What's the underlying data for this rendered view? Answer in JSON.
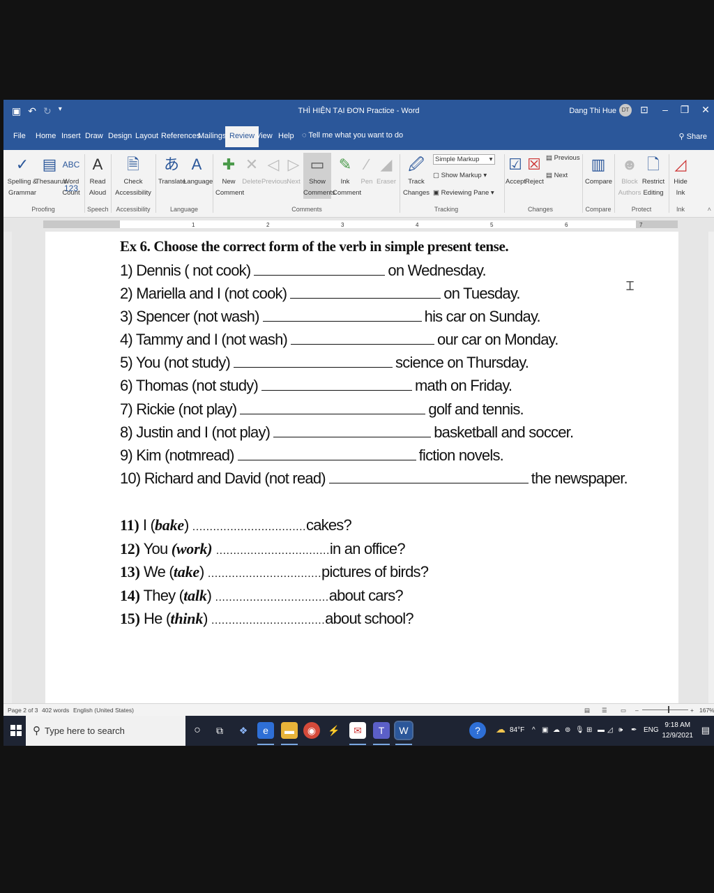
{
  "window": {
    "title": "THÌ HIỆN TẠI ĐƠN Practice  -  Word",
    "user": "Dang Thi Hue",
    "avatar_initials": "DT"
  },
  "tabs": [
    {
      "label": "File"
    },
    {
      "label": "Home"
    },
    {
      "label": "Insert"
    },
    {
      "label": "Draw"
    },
    {
      "label": "Design"
    },
    {
      "label": "Layout"
    },
    {
      "label": "References"
    },
    {
      "label": "Mailings"
    },
    {
      "label": "Review"
    },
    {
      "label": "View"
    },
    {
      "label": "Help"
    }
  ],
  "tell_me": "Tell me what you want to do",
  "share": "Share",
  "ribbon": {
    "spelling": "Spelling &\nGrammar",
    "thesaurus": "Thesaurus",
    "word_count": "Word\nCount",
    "read_aloud": "Read\nAloud",
    "check_accessibility": "Check\nAccessibility",
    "translate": "Translate",
    "language": "Language",
    "new_comment": "New\nComment",
    "delete": "Delete",
    "previous": "Previous",
    "next": "Next",
    "show_comments": "Show\nComments",
    "ink_comment": "Ink\nComment",
    "pen": "Pen",
    "eraser": "Eraser",
    "track_changes": "Track\nChanges",
    "simple_markup": "Simple Markup",
    "show_markup": "Show Markup",
    "reviewing_pane": "Reviewing Pane",
    "accept": "Accept",
    "reject": "Reject",
    "prev_change": "Previous",
    "next_change": "Next",
    "compare": "Compare",
    "block_authors": "Block\nAuthors",
    "restrict_editing": "Restrict\nEditing",
    "hide_ink": "Hide\nInk",
    "groups": {
      "proofing": "Proofing",
      "speech": "Speech",
      "accessibility": "Accessibility",
      "language": "Language",
      "comments": "Comments",
      "tracking": "Tracking",
      "changes": "Changes",
      "compare": "Compare",
      "protect": "Protect",
      "ink": "Ink"
    }
  },
  "ruler_numbers": [
    "1",
    "2",
    "3",
    "4",
    "5",
    "6",
    "7"
  ],
  "document": {
    "heading": "Ex 6. Choose the correct form of the verb in simple present tense.",
    "part1": [
      {
        "before": "1) Dennis ( not cook)",
        "after": "on Wednesday."
      },
      {
        "before": "2) Mariella and I (not cook)",
        "after": "on Tuesday."
      },
      {
        "before": "3) Spencer (not wash)",
        "after": "his car on Sunday."
      },
      {
        "before": "4) Tammy and I (not wash)",
        "after": "our car on Monday."
      },
      {
        "before": "5) You (not study)",
        "after": "science on Thursday."
      },
      {
        "before": "6) Thomas (not study)",
        "after": "math on Friday."
      },
      {
        "before": "7) Rickie (not play)",
        "after": "golf and tennis."
      },
      {
        "before": "8) Justin and I (not play)",
        "after": "basketball and soccer."
      },
      {
        "before": "9) Kim (notmread)",
        "after": "fiction novels."
      },
      {
        "before": "10) Richard and David (not read)",
        "after": "the newspaper."
      }
    ],
    "part2": [
      {
        "num": "11)",
        "subject": "I (",
        "verb": "bake",
        "close": ")",
        "after": "cakes?"
      },
      {
        "num": "12)",
        "subject": "You",
        "verb": "(work)",
        "close": "",
        "after": "in an office?"
      },
      {
        "num": "13)",
        "subject": "We (",
        "verb": "take",
        "close": ")",
        "after": "pictures of birds?"
      },
      {
        "num": "14)",
        "subject": "They (",
        "verb": "talk",
        "close": ")",
        "after": "about cars?"
      },
      {
        "num": "15)",
        "subject": "He (",
        "verb": "think",
        "close": ")",
        "after": "about school?"
      }
    ]
  },
  "status": {
    "page": "Page 2 of 3",
    "words": "402 words",
    "language": "English (United States)",
    "zoom": "167%"
  },
  "taskbar": {
    "search_placeholder": "Type here to search",
    "weather": "84°F",
    "input_lang": "ENG",
    "time": "9:18 AM",
    "date": "12/9/2021"
  }
}
